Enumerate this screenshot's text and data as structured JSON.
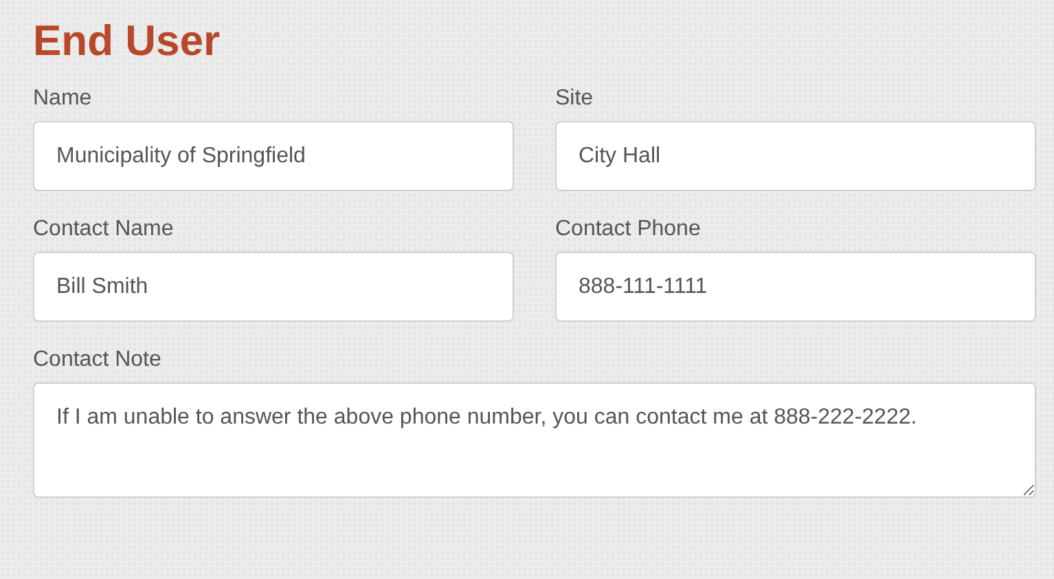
{
  "heading": "End User",
  "fields": [
    {
      "label": "Name",
      "value": "Municipality of Springfield",
      "kind": "text"
    },
    {
      "label": "Site",
      "value": "City Hall",
      "kind": "text"
    },
    {
      "label": "Contact Name",
      "value": "Bill Smith",
      "kind": "text"
    },
    {
      "label": "Contact Phone",
      "value": "888-111-1111",
      "kind": "text"
    },
    {
      "label": "Contact Note",
      "value": "If I am unable to answer the above phone number, you can contact me at 888-222-2222.",
      "kind": "textarea"
    }
  ]
}
